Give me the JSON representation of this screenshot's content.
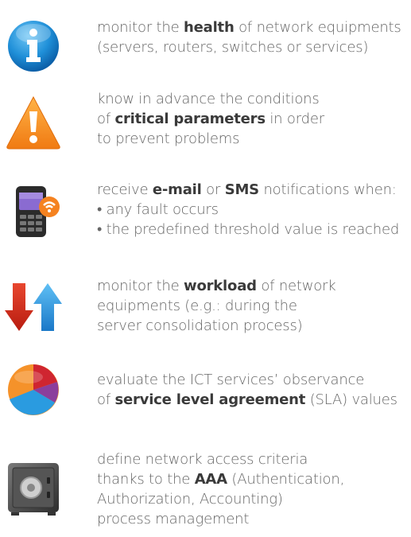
{
  "items": [
    {
      "icon": "info-icon",
      "lines": [
        [
          "monitor the ",
          {
            "b": "health"
          },
          " of network equipments"
        ],
        [
          "(servers, routers, switches or services)"
        ]
      ]
    },
    {
      "icon": "warning-icon",
      "lines": [
        [
          "know in advance the conditions"
        ],
        [
          "of ",
          {
            "b": "critical parameters"
          },
          " in order"
        ],
        [
          "to prevent problems"
        ]
      ]
    },
    {
      "icon": "mobile-phone-icon",
      "lines": [
        [
          "receive ",
          {
            "b": "e-mail"
          },
          " or ",
          {
            "b": "SMS"
          },
          " notifications when:"
        ],
        [
          "• any fault occurs"
        ],
        [
          "• the predefined threshold value is reached"
        ]
      ]
    },
    {
      "icon": "up-down-arrows-icon",
      "lines": [
        [
          "monitor the ",
          {
            "b": "workload"
          },
          " of network"
        ],
        [
          "equipments (e.g.: during the"
        ],
        [
          "server consolidation process)"
        ]
      ]
    },
    {
      "icon": "pie-chart-icon",
      "lines": [
        [
          "evaluate the ICT services’ observance"
        ],
        [
          "of ",
          {
            "b": "service level agreement"
          },
          " (SLA) values"
        ]
      ]
    },
    {
      "icon": "safe-icon",
      "lines": [
        [
          "define network access criteria"
        ],
        [
          "thanks to the ",
          {
            "b": "AAA"
          },
          " (Authentication,"
        ],
        [
          "Authorization, Accounting)"
        ],
        [
          "process management"
        ]
      ]
    }
  ]
}
